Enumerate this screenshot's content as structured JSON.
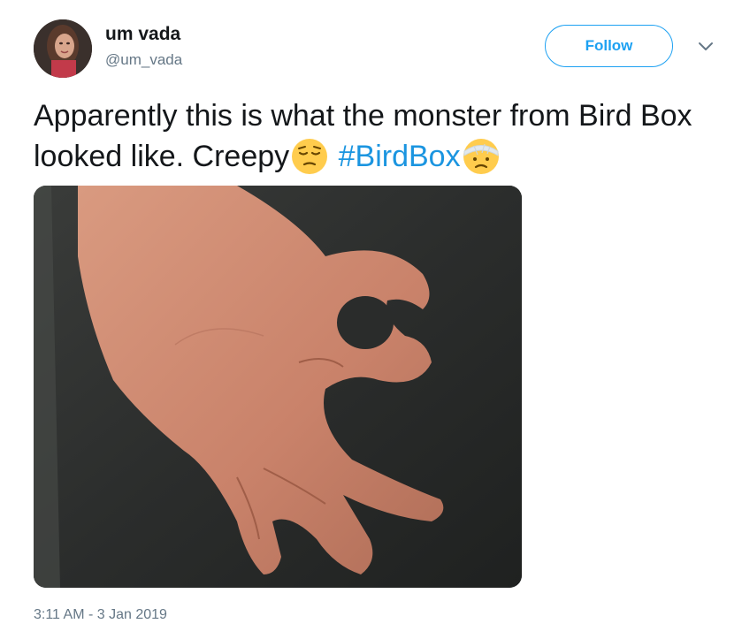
{
  "author": {
    "display_name": "um vada",
    "handle": "@um_vada"
  },
  "follow_button": {
    "label": "Follow"
  },
  "tweet": {
    "text_part1": "Apparently this is what the monster from Bird Box looked like. Creepy",
    "emoji_1": "pensive-face",
    "hashtag": "#BirdBox",
    "emoji_2": "face-with-head-bandage",
    "timestamp": "3:11 AM - 3 Jan 2019"
  },
  "colors": {
    "accent": "#1da1f2",
    "hashtag": "#1b95e0",
    "secondary_text": "#657786"
  }
}
